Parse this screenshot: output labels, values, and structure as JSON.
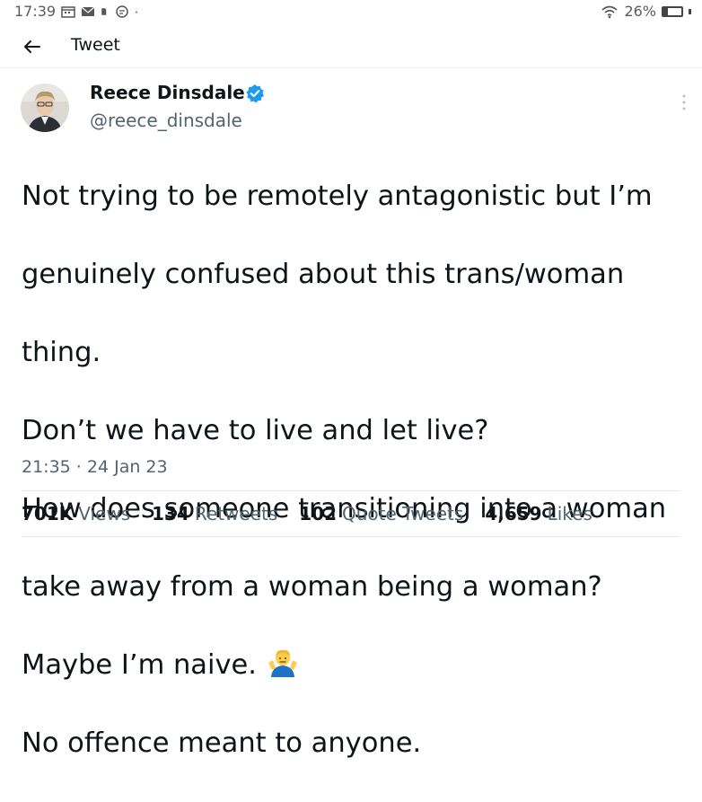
{
  "status_bar": {
    "time": "17:39",
    "battery": "26%",
    "battery_level": 0.26,
    "icons": [
      "calendar-icon",
      "mail-icon",
      "sim-icon",
      "chat-icon",
      "dot-icon",
      "wifi-icon",
      "battery-icon"
    ]
  },
  "header": {
    "title": "Tweet",
    "back_icon": "arrow-left-icon"
  },
  "tweet": {
    "author": {
      "name": "Reece Dinsdale",
      "handle": "@reece_dinsdale",
      "verified": true
    },
    "lines": [
      "Not trying to be remotely antagonistic but I’m",
      "genuinely confused about this trans/woman",
      "thing.",
      "Don’t we have to live and let live?",
      "How does someone transitioning into a woman",
      "take away from a woman being a woman?",
      "Maybe I’m naive.",
      "No offence meant to anyone."
    ],
    "emoji": "person-shrugging-emoji",
    "timestamp": "21:35 · 24 Jan 23"
  },
  "stats": [
    {
      "count": "701K",
      "label": "Views"
    },
    {
      "count": "134",
      "label": "Retweets"
    },
    {
      "count": "102",
      "label": "Quote Tweets"
    },
    {
      "count": "4,659",
      "label": "Likes"
    }
  ],
  "colors": {
    "verified": "#1d9bf0",
    "secondary_text": "#536471",
    "primary_text": "#0f1419"
  }
}
